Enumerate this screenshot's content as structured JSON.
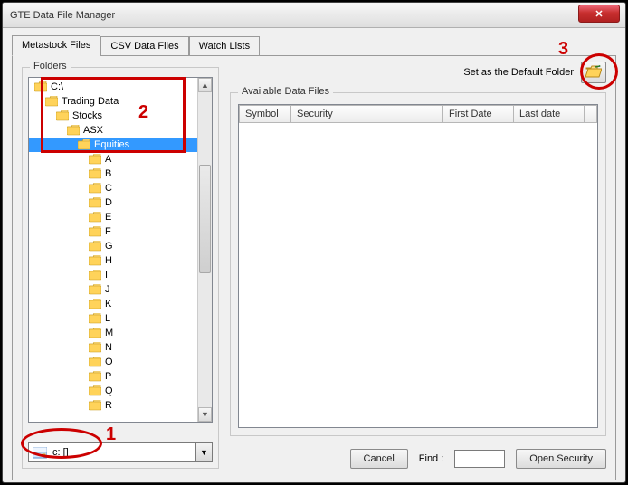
{
  "window": {
    "title": "GTE Data File Manager"
  },
  "tabs": [
    {
      "label": "Metastock Files",
      "active": true
    },
    {
      "label": "CSV Data Files",
      "active": false
    },
    {
      "label": "Watch Lists",
      "active": false
    }
  ],
  "folders": {
    "legend": "Folders",
    "items": [
      {
        "label": "C:\\",
        "depth": 0
      },
      {
        "label": "Trading Data",
        "depth": 1
      },
      {
        "label": "Stocks",
        "depth": 2
      },
      {
        "label": "ASX",
        "depth": 3
      },
      {
        "label": "Equities",
        "depth": 4,
        "selected": true
      },
      {
        "label": "A",
        "depth": 5
      },
      {
        "label": "B",
        "depth": 5
      },
      {
        "label": "C",
        "depth": 5
      },
      {
        "label": "D",
        "depth": 5
      },
      {
        "label": "E",
        "depth": 5
      },
      {
        "label": "F",
        "depth": 5
      },
      {
        "label": "G",
        "depth": 5
      },
      {
        "label": "H",
        "depth": 5
      },
      {
        "label": "I",
        "depth": 5
      },
      {
        "label": "J",
        "depth": 5
      },
      {
        "label": "K",
        "depth": 5
      },
      {
        "label": "L",
        "depth": 5
      },
      {
        "label": "M",
        "depth": 5
      },
      {
        "label": "N",
        "depth": 5
      },
      {
        "label": "O",
        "depth": 5
      },
      {
        "label": "P",
        "depth": 5
      },
      {
        "label": "Q",
        "depth": 5
      },
      {
        "label": "R",
        "depth": 5
      }
    ],
    "drive": "c: []"
  },
  "right": {
    "set_default_label": "Set as the Default Folder",
    "available_legend": "Available Data Files",
    "columns": {
      "symbol": "Symbol",
      "security": "Security",
      "first": "First  Date",
      "last": "Last date"
    },
    "cancel": "Cancel",
    "find_label": "Find :",
    "open_security": "Open Security"
  },
  "annotations": {
    "n1": "1",
    "n2": "2",
    "n3": "3"
  },
  "colors": {
    "highlight": "#cc0000",
    "selection": "#3399ff"
  }
}
